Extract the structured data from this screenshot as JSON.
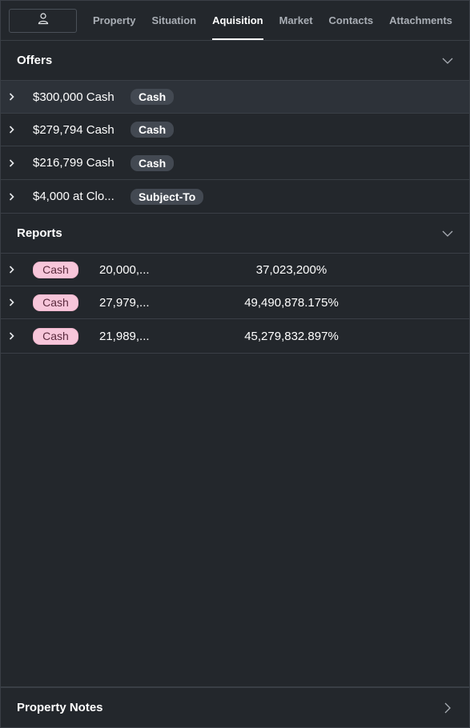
{
  "nav": {
    "avatar_icon": "user-icon",
    "tabs": [
      {
        "label": "Property",
        "active": false
      },
      {
        "label": "Situation",
        "active": false
      },
      {
        "label": "Aquisition",
        "active": true
      },
      {
        "label": "Market",
        "active": false
      },
      {
        "label": "Contacts",
        "active": false
      },
      {
        "label": "Attachments",
        "active": false
      }
    ]
  },
  "offers": {
    "title": "Offers",
    "items": [
      {
        "amount": "$300,000 Cash",
        "type": "Cash"
      },
      {
        "amount": "$279,794 Cash",
        "type": "Cash"
      },
      {
        "amount": "$216,799 Cash",
        "type": "Cash"
      },
      {
        "amount": "$4,000 at Clo...",
        "type": "Subject-To"
      }
    ]
  },
  "reports": {
    "title": "Reports",
    "items": [
      {
        "type": "Cash",
        "amount": "20,000,...",
        "percent": "37,023,200%"
      },
      {
        "type": "Cash",
        "amount": "27,979,...",
        "percent": "49,490,878.175%"
      },
      {
        "type": "Cash",
        "amount": "21,989,...",
        "percent": "45,279,832.897%"
      }
    ]
  },
  "notes": {
    "title": "Property Notes"
  },
  "colors": {
    "background": "#23272c",
    "divider": "#3a3f46",
    "pill_dark": "#434952",
    "pill_pink": "#f7c6da"
  }
}
